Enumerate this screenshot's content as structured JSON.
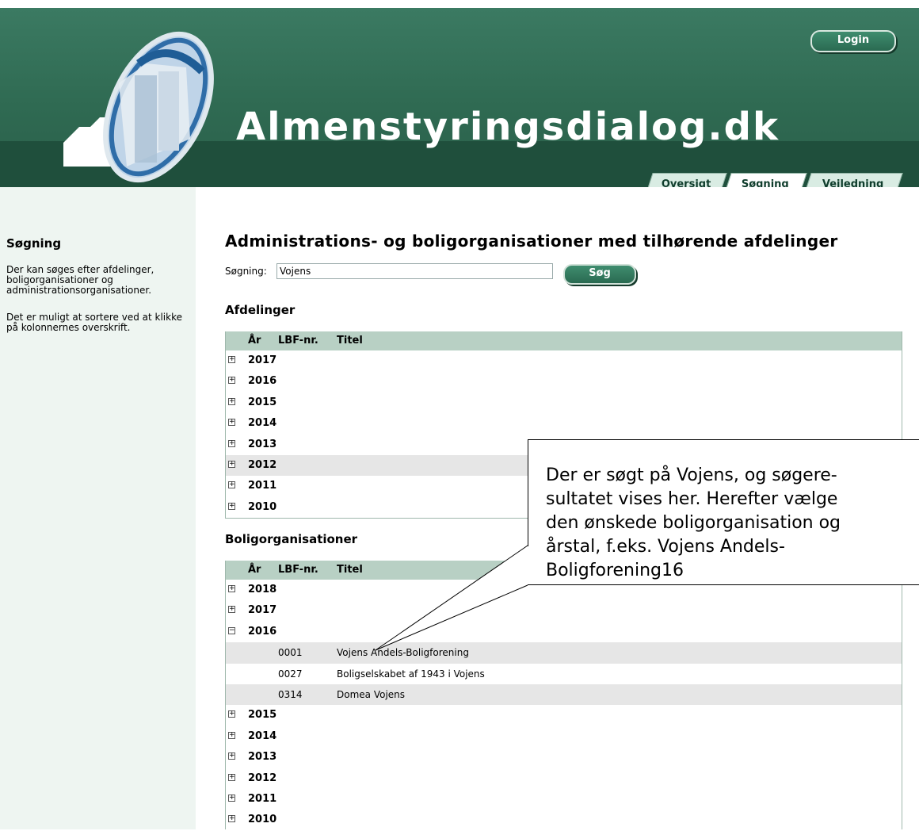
{
  "header": {
    "brand": "Almenstyringsdialog.dk",
    "login_label": "Login",
    "tabs": [
      "Oversigt",
      "Søgning",
      "Vejledning"
    ],
    "active_tab": "Søgning",
    "colors": {
      "header": "#2f6a52",
      "band": "#1f4f3c",
      "button": "#2a6a51"
    }
  },
  "sidebar": {
    "title": "Søgning",
    "paragraphs": [
      "Der kan søges efter afdelinger, boligorganisationer og administrationsorganisationer.",
      "Det er muligt at sortere ved at klikke på kolonnernes overskrift."
    ]
  },
  "main": {
    "title": "Administrations- og boligorganisationer med tilhørende afdelinger",
    "search": {
      "label": "Søgning:",
      "value": "Vojens",
      "button": "Søg"
    },
    "columns": [
      "År",
      "LBF-nr.",
      "Titel"
    ],
    "afdelinger": {
      "title": "Afdelinger",
      "rows": [
        {
          "year": "2017",
          "toggle": "+"
        },
        {
          "year": "2016",
          "toggle": "+"
        },
        {
          "year": "2015",
          "toggle": "+"
        },
        {
          "year": "2014",
          "toggle": "+"
        },
        {
          "year": "2013",
          "toggle": "+"
        },
        {
          "year": "2012",
          "toggle": "+"
        },
        {
          "year": "2011",
          "toggle": "+"
        },
        {
          "year": "2010",
          "toggle": "+"
        }
      ]
    },
    "boligorganisationer": {
      "title": "Boligorganisationer",
      "rows": [
        {
          "year": "2018",
          "toggle": "+"
        },
        {
          "year": "2017",
          "toggle": "+"
        },
        {
          "year": "2016",
          "toggle": "−"
        },
        {
          "lbf": "0001",
          "title": "Vojens Andels-Boligforening"
        },
        {
          "lbf": "0027",
          "title": "Boligselskabet af 1943 i Vojens"
        },
        {
          "lbf": "0314",
          "title": "Domea Vojens"
        },
        {
          "year": "2015",
          "toggle": "+"
        },
        {
          "year": "2014",
          "toggle": "+"
        },
        {
          "year": "2013",
          "toggle": "+"
        },
        {
          "year": "2012",
          "toggle": "+"
        },
        {
          "year": "2011",
          "toggle": "+"
        },
        {
          "year": "2010",
          "toggle": "+"
        }
      ]
    }
  },
  "callout": {
    "text": "Der er søgt på Vojens, og søgere-\nsultatet vises her. Herefter vælge\nden ønskede boligorganisation og\nårstal, f.eks. Vojens Andels-\nBoligforening16"
  }
}
